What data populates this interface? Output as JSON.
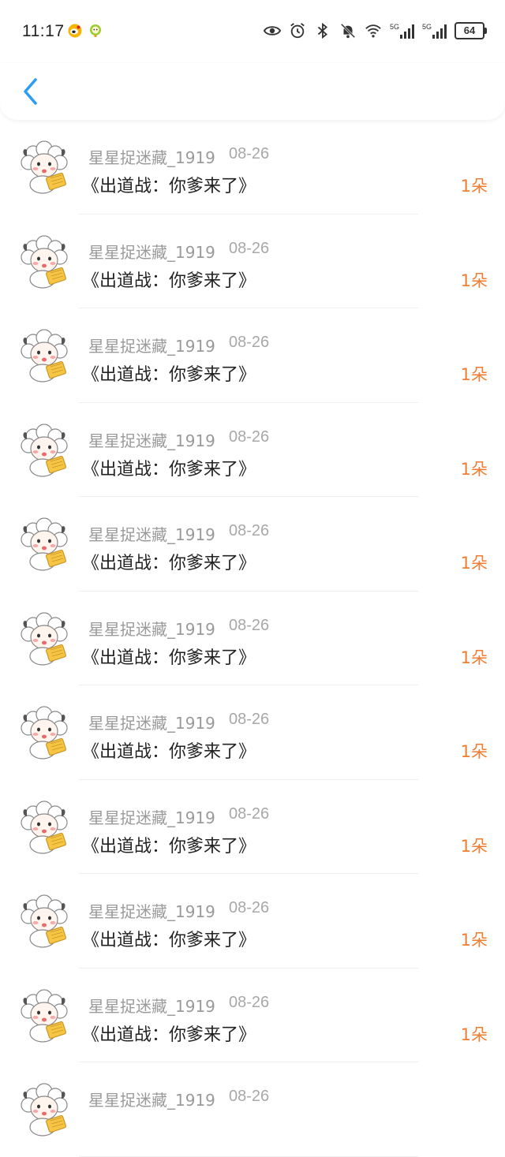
{
  "status_bar": {
    "time": "11:17",
    "battery": "64",
    "network_label_1": "5G",
    "network_label_2": "5G"
  },
  "nav": {
    "back_icon": "chevron-left-icon",
    "accent_color": "#2a9df4"
  },
  "colors": {
    "count": "#f07d33",
    "username": "#9a9a9a",
    "message": "#222222"
  },
  "list": {
    "items": [
      {
        "user": "星星捉迷藏_1919",
        "date": "08-26",
        "message": "《出道战：你爹来了》",
        "count": "1朵"
      },
      {
        "user": "星星捉迷藏_1919",
        "date": "08-26",
        "message": "《出道战：你爹来了》",
        "count": "1朵"
      },
      {
        "user": "星星捉迷藏_1919",
        "date": "08-26",
        "message": "《出道战：你爹来了》",
        "count": "1朵"
      },
      {
        "user": "星星捉迷藏_1919",
        "date": "08-26",
        "message": "《出道战：你爹来了》",
        "count": "1朵"
      },
      {
        "user": "星星捉迷藏_1919",
        "date": "08-26",
        "message": "《出道战：你爹来了》",
        "count": "1朵"
      },
      {
        "user": "星星捉迷藏_1919",
        "date": "08-26",
        "message": "《出道战：你爹来了》",
        "count": "1朵"
      },
      {
        "user": "星星捉迷藏_1919",
        "date": "08-26",
        "message": "《出道战：你爹来了》",
        "count": "1朵"
      },
      {
        "user": "星星捉迷藏_1919",
        "date": "08-26",
        "message": "《出道战：你爹来了》",
        "count": "1朵"
      },
      {
        "user": "星星捉迷藏_1919",
        "date": "08-26",
        "message": "《出道战：你爹来了》",
        "count": "1朵"
      },
      {
        "user": "星星捉迷藏_1919",
        "date": "08-26",
        "message": "《出道战：你爹来了》",
        "count": "1朵"
      },
      {
        "user": "星星捉迷藏_1919",
        "date": "08-26",
        "message": "",
        "count": ""
      }
    ]
  }
}
